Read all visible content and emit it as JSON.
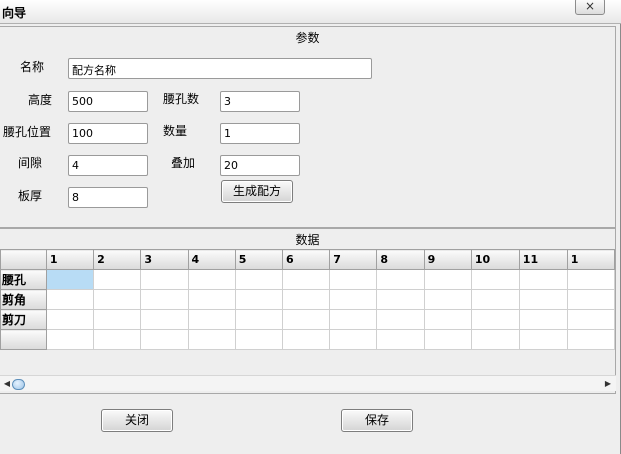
{
  "window": {
    "title": "向导",
    "close_glyph": "×"
  },
  "params": {
    "legend": "参数",
    "name_label": "名称",
    "name_value": "配方名称",
    "height_label": "高度",
    "height_value": "500",
    "waist_hole_count_label": "腰孔数",
    "waist_hole_count_value": "3",
    "waist_hole_pos_label": "腰孔位置",
    "waist_hole_pos_value": "100",
    "quantity_label": "数量",
    "quantity_value": "1",
    "gap_label": "间隙",
    "gap_value": "4",
    "stack_label": "叠加",
    "stack_value": "20",
    "thickness_label": "板厚",
    "thickness_value": "8",
    "generate_button": "生成配方"
  },
  "data": {
    "legend": "数据",
    "columns": [
      "1",
      "2",
      "3",
      "4",
      "5",
      "6",
      "7",
      "8",
      "9",
      "10",
      "11",
      "1"
    ],
    "rows": [
      {
        "label": "腰孔",
        "cells": [
          "",
          "",
          "",
          "",
          "",
          "",
          "",
          "",
          "",
          "",
          "",
          ""
        ]
      },
      {
        "label": "剪角",
        "cells": [
          "",
          "",
          "",
          "",
          "",
          "",
          "",
          "",
          "",
          "",
          "",
          ""
        ]
      },
      {
        "label": "剪刀",
        "cells": [
          "",
          "",
          "",
          "",
          "",
          "",
          "",
          "",
          "",
          "",
          "",
          ""
        ]
      },
      {
        "label": "",
        "cells": [
          "",
          "",
          "",
          "",
          "",
          "",
          "",
          "",
          "",
          "",
          "",
          ""
        ]
      }
    ],
    "selected_cell": {
      "row": 0,
      "col": 0
    },
    "scroll": {
      "left_arrow": "◀",
      "right_arrow": "▶"
    }
  },
  "footer": {
    "close_button": "关闭",
    "save_button": "保存"
  },
  "colors": {
    "selection": "#b8dcf5",
    "window_bg": "#eeeeee",
    "border": "#a8a8a8"
  },
  "icons": {
    "close": "close-icon",
    "scroll_left": "arrow-left-icon",
    "scroll_right": "arrow-right-icon"
  }
}
